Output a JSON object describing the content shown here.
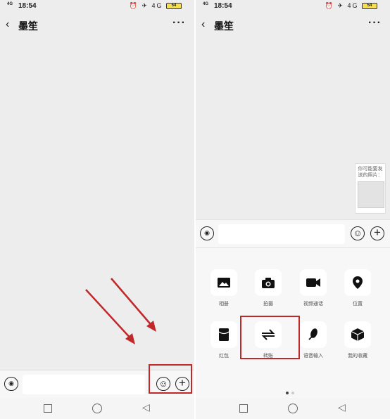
{
  "status": {
    "signal": "4G",
    "time": "18:54",
    "icons": "⏰ ✈ 4G",
    "battery": "54"
  },
  "header": {
    "back_icon": "‹",
    "title": "墨笙",
    "more_icon": "···"
  },
  "input": {
    "voice_icon": "voice-icon",
    "emoji_icon": "emoji-icon",
    "plus_icon": "plus-icon"
  },
  "photo_suggest": {
    "text": "你可能要发送的照片："
  },
  "panel": {
    "items": [
      {
        "label": "相册",
        "icon": "image-icon"
      },
      {
        "label": "拍摄",
        "icon": "camera-icon"
      },
      {
        "label": "视频通话",
        "icon": "video-call-icon"
      },
      {
        "label": "位置",
        "icon": "location-icon"
      },
      {
        "label": "红包",
        "icon": "red-packet-icon"
      },
      {
        "label": "转账",
        "icon": "transfer-icon"
      },
      {
        "label": "语音输入",
        "icon": "microphone-icon"
      },
      {
        "label": "我的收藏",
        "icon": "favorites-icon"
      }
    ],
    "page_dots": 2,
    "active_dot": 1
  },
  "colors": {
    "highlight": "#c0282a",
    "chat_bg": "#ededed"
  }
}
